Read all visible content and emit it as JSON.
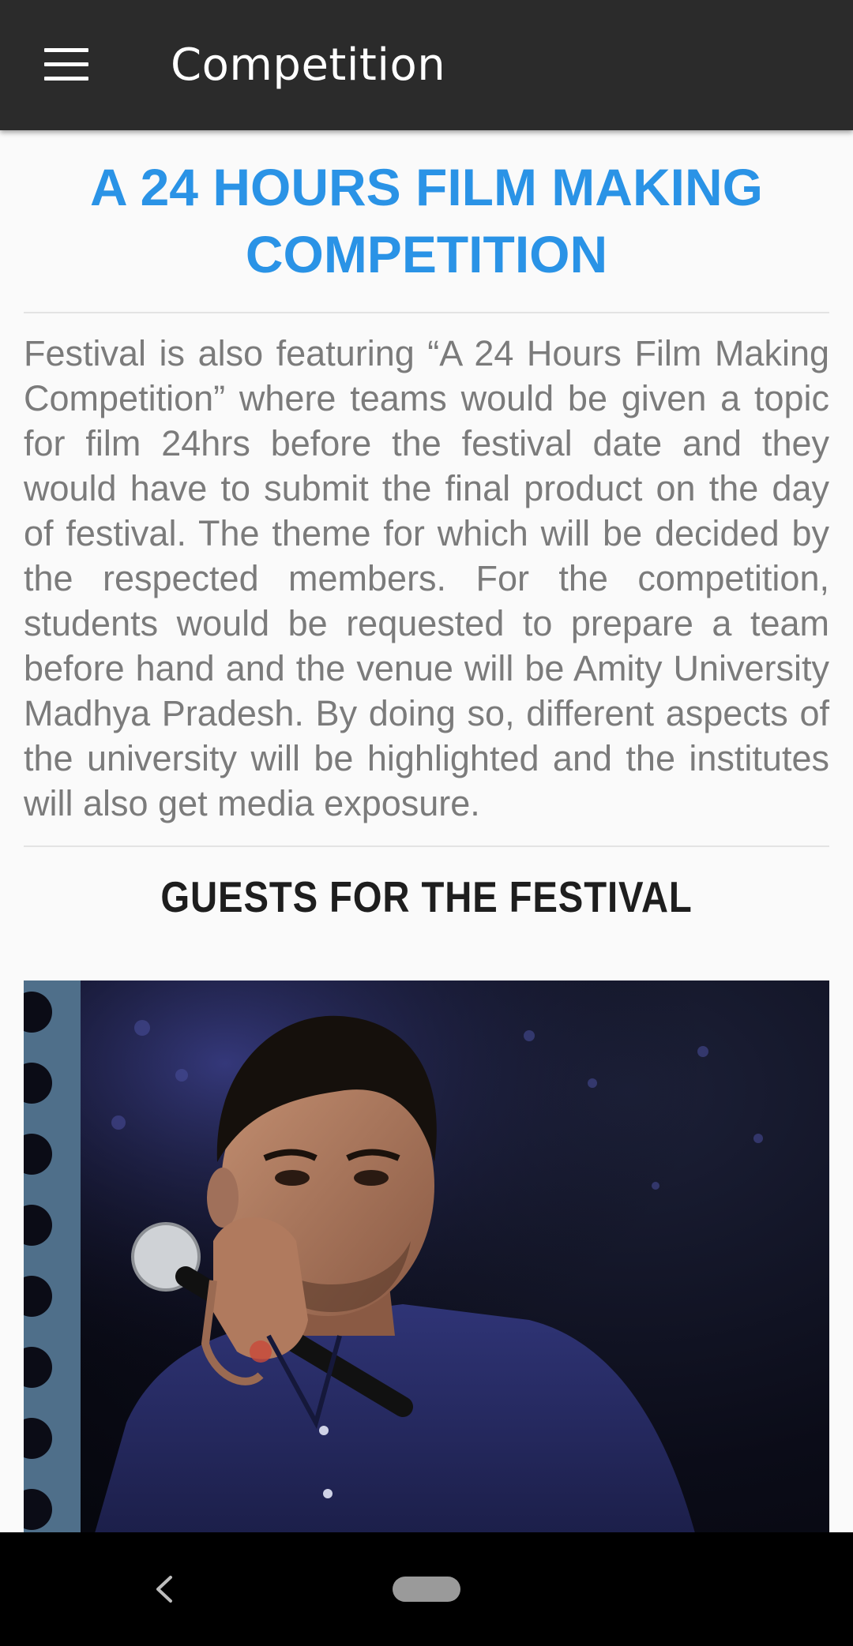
{
  "app_bar": {
    "title": "Competition",
    "menu_icon": "hamburger-menu-icon"
  },
  "content": {
    "heading": "A 24 HOURS FILM MAKING COMPETITION",
    "description": "Festival is also featuring “A 24 Hours Film Making Competition” where teams would be given a topic for film 24hrs before the festival date and they would have to submit the final product on the day of festival. The theme for which will be decided by the respected members. For the competition, students would be requested to prepare a team before hand and the venue will be Amity University Madhya Pradesh. By doing so, different aspects of the university will be highlighted and the institutes will also get media exposure.",
    "guests_heading": "GUESTS FOR THE FESTIVAL"
  },
  "nav_bar": {
    "back_icon": "back-chevron-icon",
    "home_icon": "home-pill-icon"
  },
  "colors": {
    "app_bar": "#2b2b2b",
    "heading": "#2a93e6",
    "body_text": "#7b7b7b"
  }
}
